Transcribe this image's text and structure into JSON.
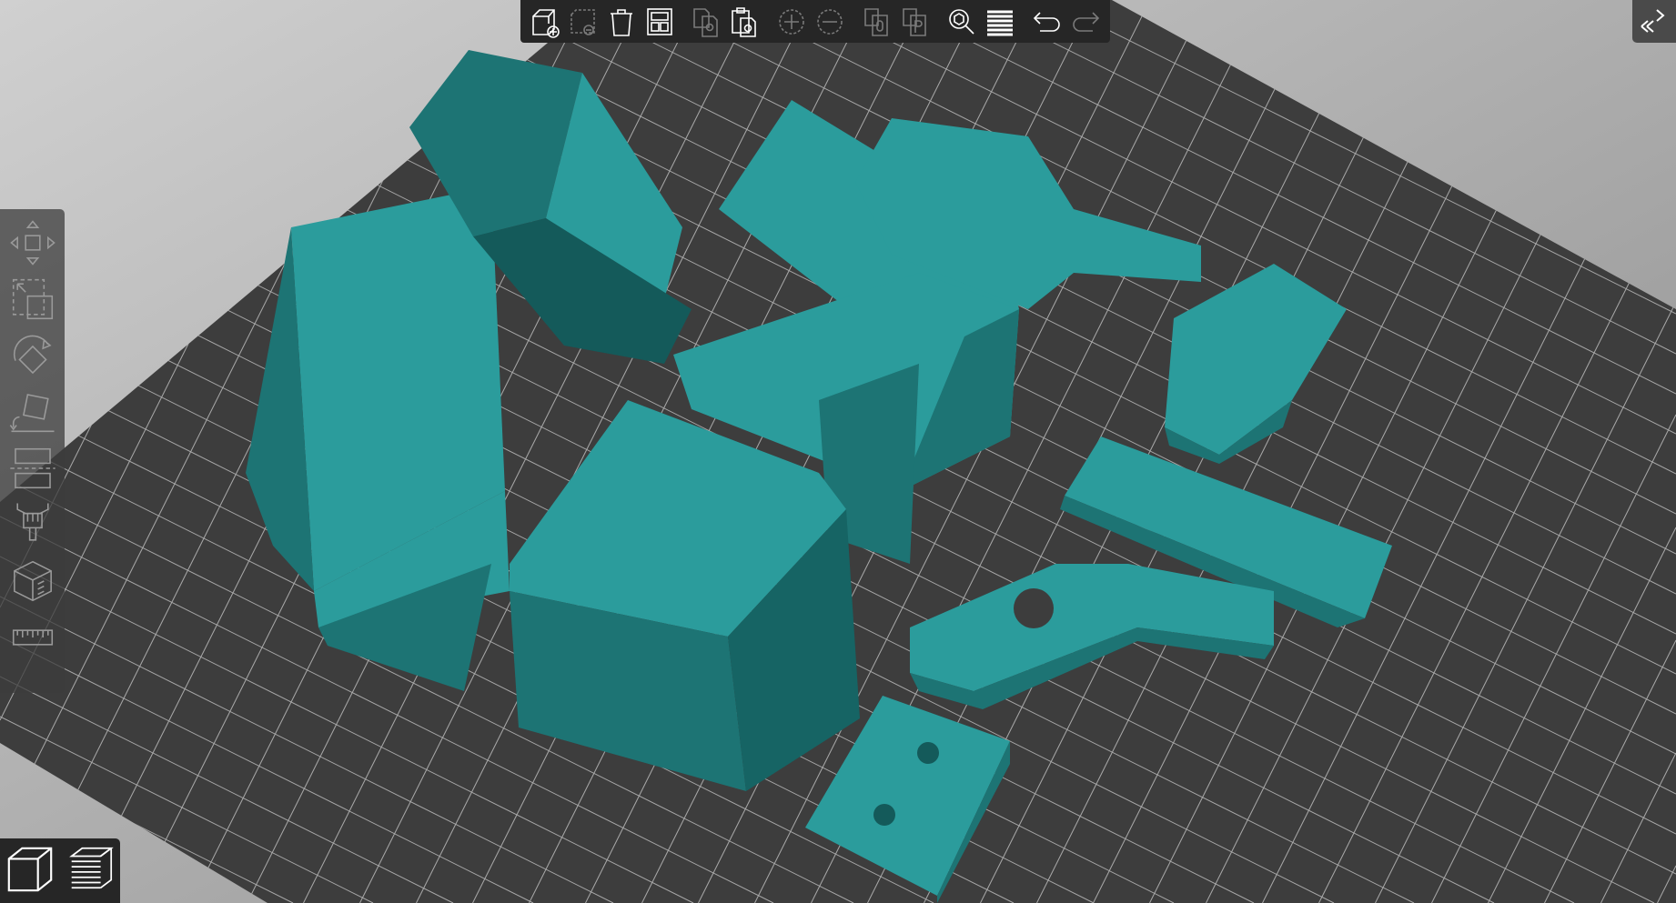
{
  "colors": {
    "background_light": "#cfcfcf",
    "background_dark": "#8e8e8e",
    "bed": "#3d3d3d",
    "grid": "#d8d8d8",
    "model": "#2b9c9c",
    "model_dark": "#1d7474",
    "model_shadow": "#145a5a",
    "toolbar_bg": "#262626",
    "icon_active": "#ffffff",
    "icon_disabled": "#7a7a7a"
  },
  "top_toolbar": [
    {
      "icon": "add-object-icon",
      "enabled": true
    },
    {
      "icon": "delete-object-icon",
      "enabled": false
    },
    {
      "icon": "delete-all-icon",
      "enabled": true
    },
    {
      "icon": "arrange-icon",
      "enabled": true
    },
    {
      "icon": "copy-icon",
      "enabled": false
    },
    {
      "icon": "paste-icon",
      "enabled": true
    },
    {
      "icon": "add-instance-icon",
      "enabled": false
    },
    {
      "icon": "remove-instance-icon",
      "enabled": false
    },
    {
      "icon": "split-to-objects-icon",
      "enabled": false
    },
    {
      "icon": "split-to-parts-icon",
      "enabled": false
    },
    {
      "icon": "search-icon",
      "enabled": true
    },
    {
      "icon": "layers-editing-icon",
      "enabled": true
    },
    {
      "icon": "undo-icon",
      "enabled": true
    },
    {
      "icon": "redo-icon",
      "enabled": false
    }
  ],
  "left_tools": [
    "move-icon",
    "scale-icon",
    "rotate-icon",
    "place-on-face-icon",
    "cut-icon",
    "paint-supports-icon",
    "seam-painting-icon",
    "measure-icon"
  ],
  "view_switch": [
    "3d-view-icon",
    "preview-layers-icon"
  ],
  "sidebar_toggle": "collapse-sidebar-icon"
}
